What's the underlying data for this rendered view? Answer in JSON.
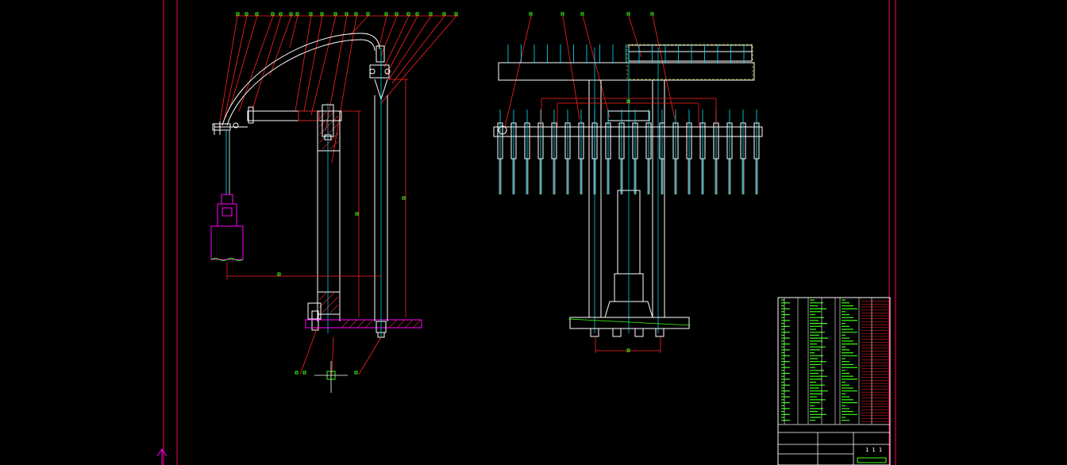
{
  "drawing": {
    "title_block_text": "1 1 1"
  },
  "colors": {
    "background": "#000000",
    "frame": "#ff0055",
    "outline": "#ffffff",
    "leader": "#ff2020",
    "centerline": "#00e5ff",
    "marker": "#39ff14",
    "magenta": "#ff00ff",
    "hatch": "#cc2a2a"
  },
  "icons": {
    "north_arrow": "arrow-up-icon"
  }
}
